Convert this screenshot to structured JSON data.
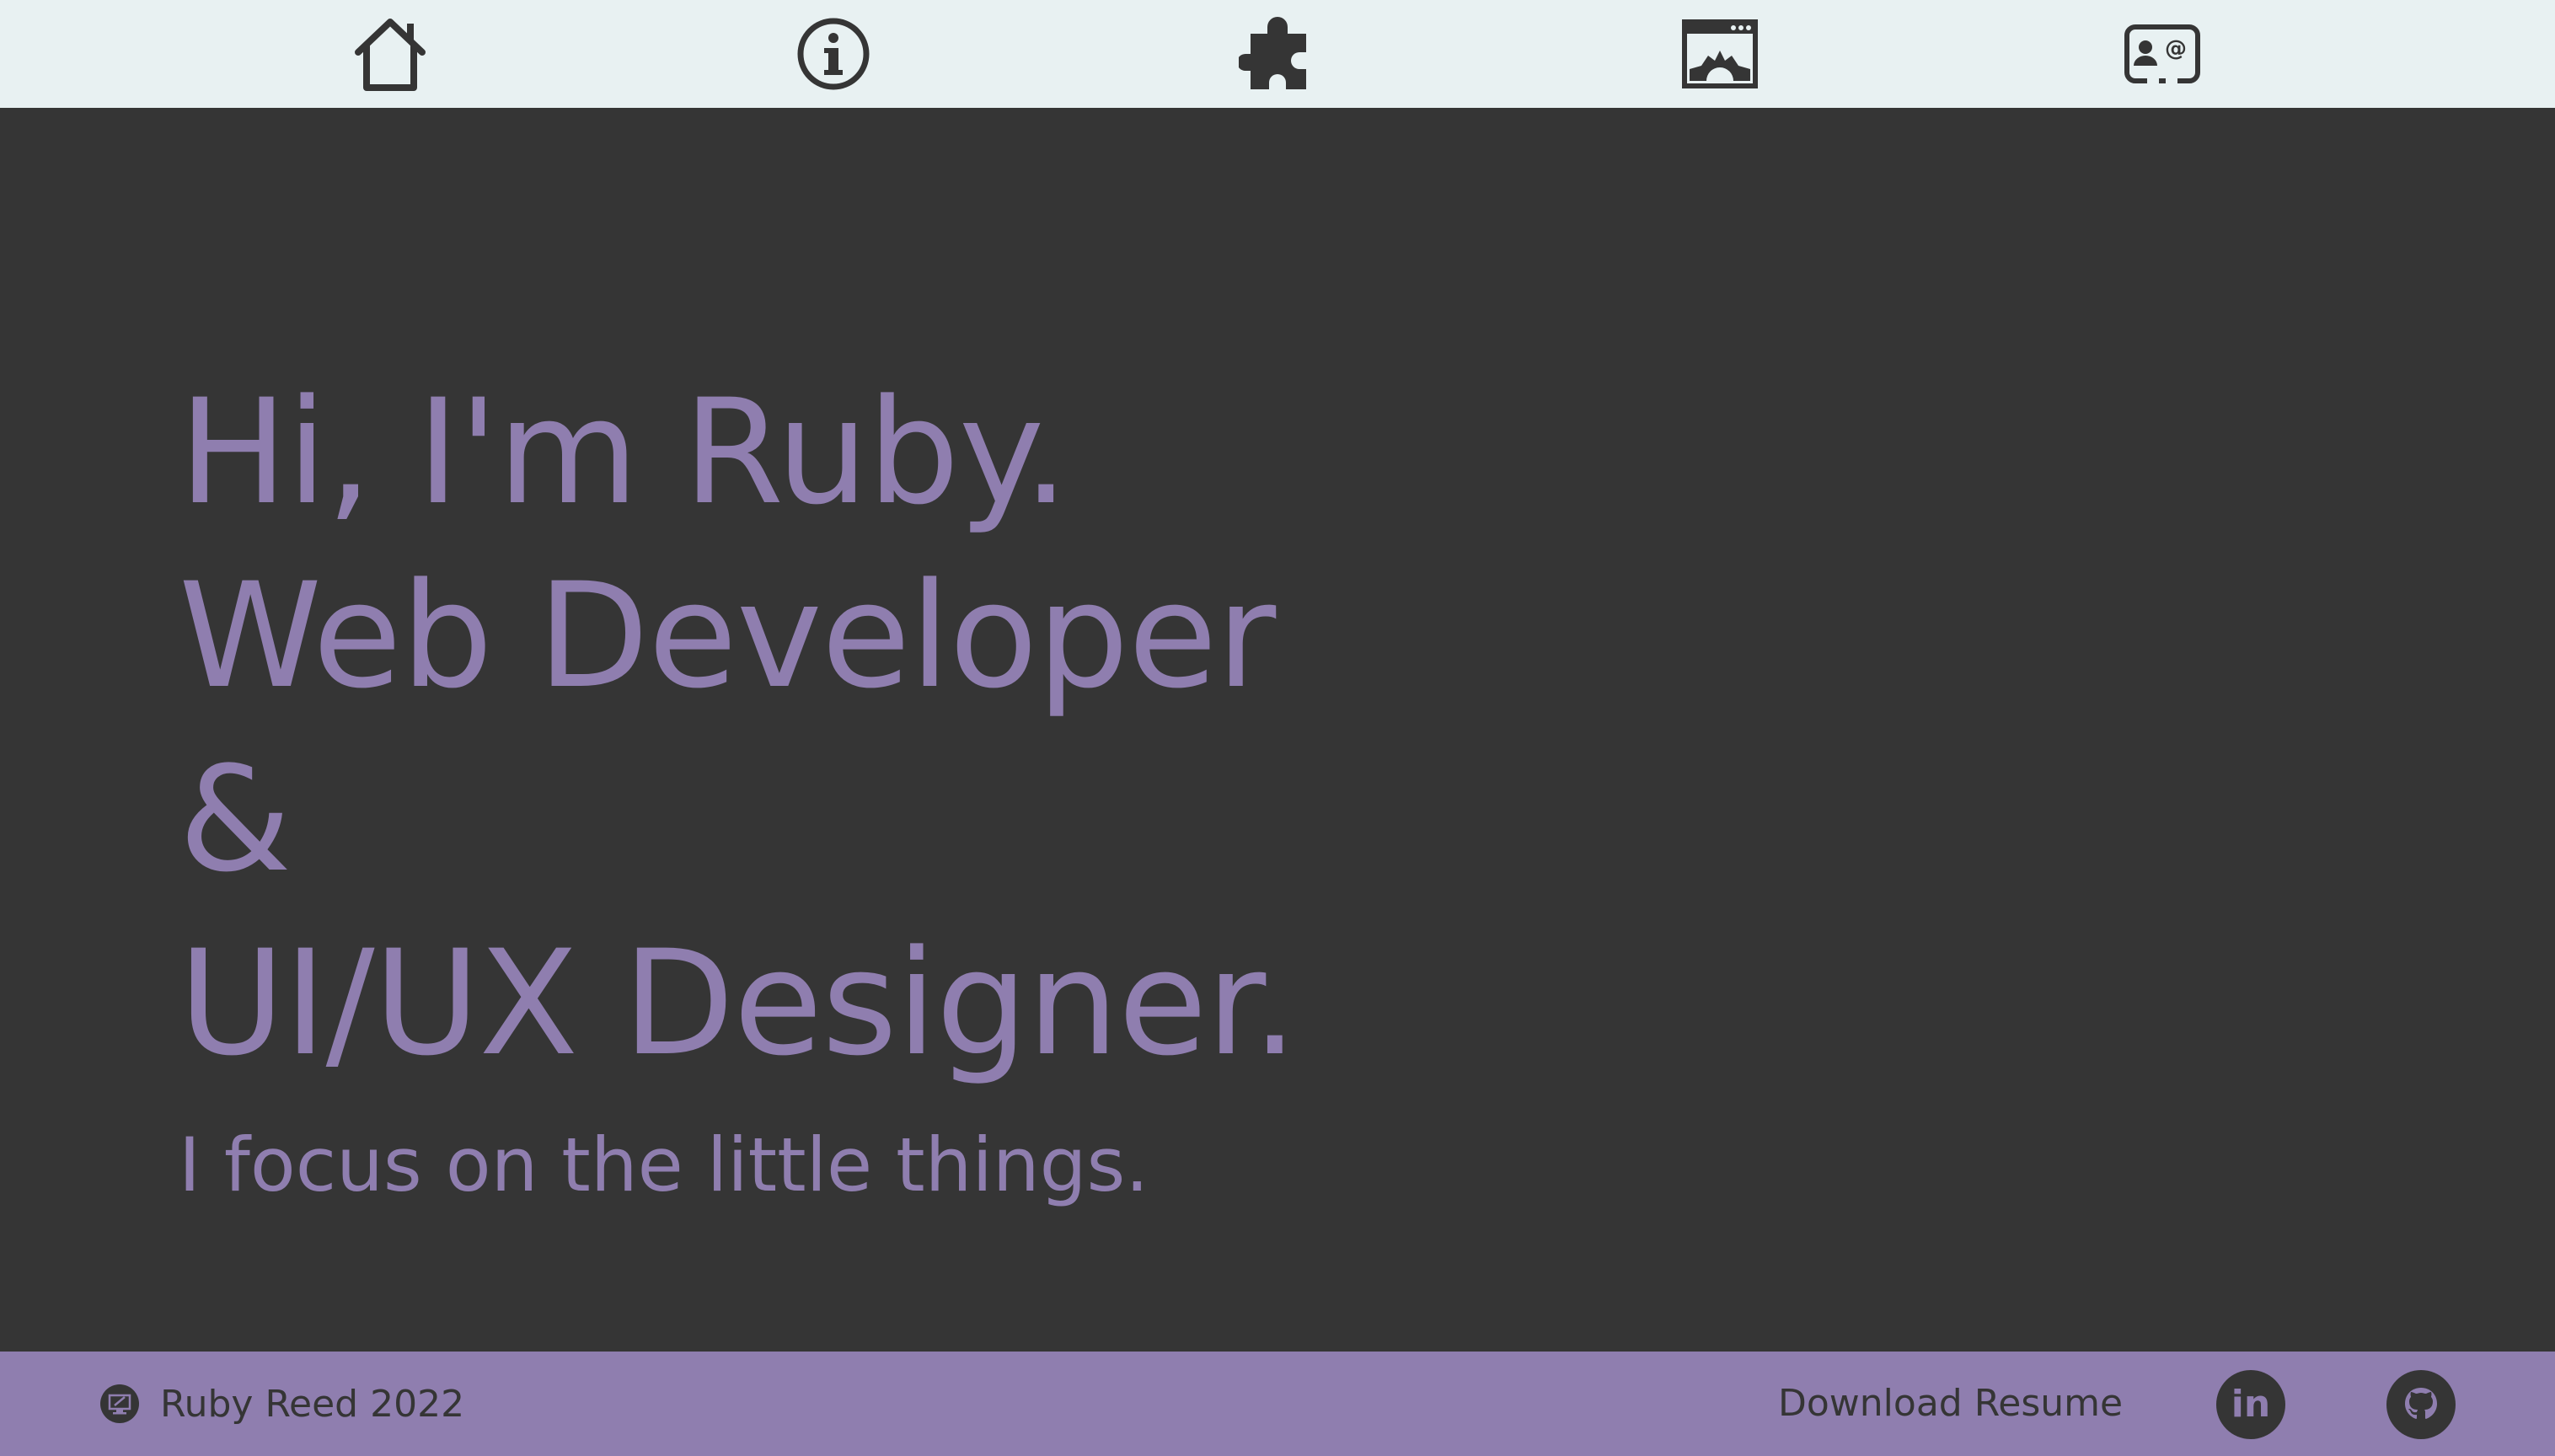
{
  "nav": {
    "items": [
      {
        "icon": "home-icon"
      },
      {
        "icon": "info-icon"
      },
      {
        "icon": "puzzle-icon"
      },
      {
        "icon": "portfolio-window-icon"
      },
      {
        "icon": "contact-card-icon"
      }
    ]
  },
  "hero": {
    "line1": "Hi, I'm Ruby.",
    "line2": "Web Developer",
    "line3": "&",
    "line4": "UI/UX Designer.",
    "tagline": "I focus on the little things."
  },
  "footer": {
    "copyright": "Ruby Reed 2022",
    "copyright_icon": "monitor-badge-icon",
    "download_label": "Download Resume",
    "linkedin_label": "in",
    "github_icon": "github-icon"
  },
  "colors": {
    "nav_background": "#e8f1f2",
    "page_background": "#353535",
    "accent": "#8f7eaf",
    "icon_dark": "#353535"
  }
}
